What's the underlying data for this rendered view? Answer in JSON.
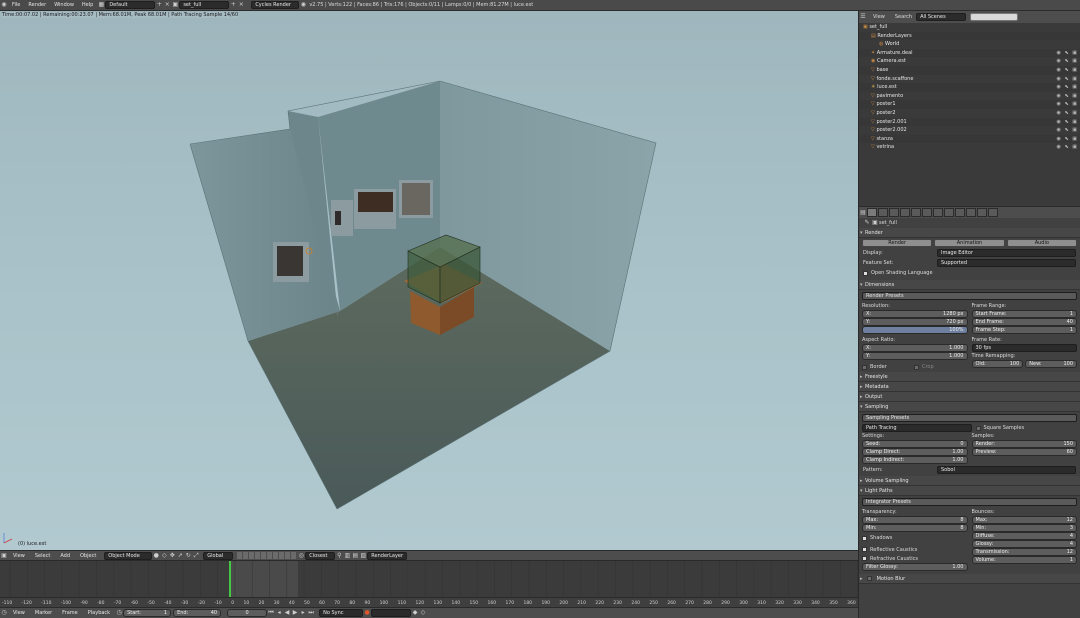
{
  "topbar": {
    "menus": [
      "File",
      "Render",
      "Window",
      "Help"
    ],
    "layout": "Default",
    "scene": "set_full",
    "engine": "Cycles Render",
    "stats": "v2.75 | Verts:122 | Faces:86 | Tris:176 | Objects:0/11 | Lamps:0/0 | Mem:81.27M | luce.est"
  },
  "viewport": {
    "info": "Time:00:07.02 | Remaining:00:23.07 | Mem:68.01M, Peak 68.01M | Path Tracing Sample 14/60",
    "object_name": "(0) luce.est"
  },
  "vp_header": {
    "menus": [
      "View",
      "Select",
      "Add",
      "Object"
    ],
    "mode": "Object Mode",
    "orientation": "Global",
    "proportional": "Closest",
    "layer": "RenderLayer"
  },
  "ruler": [
    "-110",
    "-120",
    "-110",
    "-100",
    "-90",
    "-80",
    "-70",
    "-60",
    "-50",
    "-40",
    "-30",
    "-20",
    "-10",
    "0",
    "10",
    "20",
    "30",
    "40",
    "50",
    "60",
    "70",
    "80",
    "90",
    "100",
    "110",
    "120",
    "130",
    "140",
    "150",
    "160",
    "170",
    "180",
    "190",
    "200",
    "210",
    "220",
    "230",
    "240",
    "250",
    "260",
    "270",
    "280",
    "290",
    "300",
    "310",
    "320",
    "330",
    "340",
    "350",
    "360"
  ],
  "tl_header": {
    "menus": [
      "View",
      "Marker",
      "Frame",
      "Playback"
    ],
    "start_label": "Start:",
    "start_value": "1",
    "end_label": "End:",
    "end_value": "40",
    "current": "0",
    "sync": "No Sync"
  },
  "outliner": {
    "view": "View",
    "search": "Search",
    "scenes": "All Scenes",
    "items": [
      "set_full",
      "RenderLayers",
      "World",
      "Armature.deal",
      "Camera.est",
      "base",
      "fonde.scaffone",
      "luce.est",
      "pavimento",
      "poster1",
      "poster2",
      "poster2.001",
      "poster2.002",
      "stanza",
      "vetrina"
    ]
  },
  "properties": {
    "context": "set_full",
    "render_panel": "Render",
    "render_btn": "Render",
    "animation_btn": "Animation",
    "audio_btn": "Audio",
    "display_label": "Display:",
    "display_value": "Image Editor",
    "feature_label": "Feature Set:",
    "feature_value": "Supported",
    "osl": "Open Shading Language",
    "dimensions_panel": "Dimensions",
    "render_presets": "Render Presets",
    "resolution_label": "Resolution:",
    "res_x_label": "X:",
    "res_x": "1280 px",
    "res_y_label": "Y:",
    "res_y": "720 px",
    "res_pct": "100%",
    "frame_range_label": "Frame Range:",
    "start_frame_label": "Start Frame:",
    "start_frame": "1",
    "end_frame_label": "End Frame:",
    "end_frame": "40",
    "frame_step_label": "Frame Step:",
    "frame_step": "1",
    "aspect_label": "Aspect Ratio:",
    "asp_x_label": "X:",
    "asp_x": "1.000",
    "asp_y_label": "Y:",
    "asp_y": "1.000",
    "frame_rate_label": "Frame Rate:",
    "frame_rate": "30 fps",
    "time_remap_label": "Time Remapping:",
    "old_label": "Old:",
    "old": "100",
    "new_label": "New:",
    "new": "100",
    "border": "Border",
    "crop": "Crop",
    "freestyle": "Freestyle",
    "metadata": "Metadata",
    "output": "Output",
    "sampling_panel": "Sampling",
    "sampling_presets": "Sampling Presets",
    "path_tracing": "Path Tracing",
    "square_samples": "Square Samples",
    "settings_label": "Settings:",
    "seed_label": "Seed:",
    "seed": "0",
    "clamp_direct_label": "Clamp Direct:",
    "clamp_direct": "1.00",
    "clamp_indirect_label": "Clamp Indirect:",
    "clamp_indirect": "1.00",
    "samples_label": "Samples:",
    "render_samples_label": "Render:",
    "render_samples": "150",
    "preview_samples_label": "Preview:",
    "preview_samples": "60",
    "pattern_label": "Pattern:",
    "pattern": "Sobol",
    "volume_sampling": "Volume Sampling",
    "light_paths": "Light Paths",
    "integrator_presets": "Integrator Presets",
    "transparency_label": "Transparency:",
    "t_max_label": "Max:",
    "t_max": "8",
    "t_min_label": "Min:",
    "t_min": "8",
    "bounces_label": "Bounces:",
    "b_max_label": "Max:",
    "b_max": "12",
    "b_min_label": "Min:",
    "b_min": "3",
    "diffuse_label": "Diffuse:",
    "diffuse": "4",
    "glossy_label": "Glossy:",
    "glossy": "4",
    "transmission_label": "Transmission:",
    "transmission": "12",
    "volume_label": "Volume:",
    "volume": "1",
    "shadows": "Shadows",
    "reflective_caustics": "Reflective Caustics",
    "refractive_caustics": "Refractive Caustics",
    "filter_glossy_label": "Filter Glossy:",
    "filter_glossy": "1.00",
    "motion_blur": "Motion Blur"
  }
}
